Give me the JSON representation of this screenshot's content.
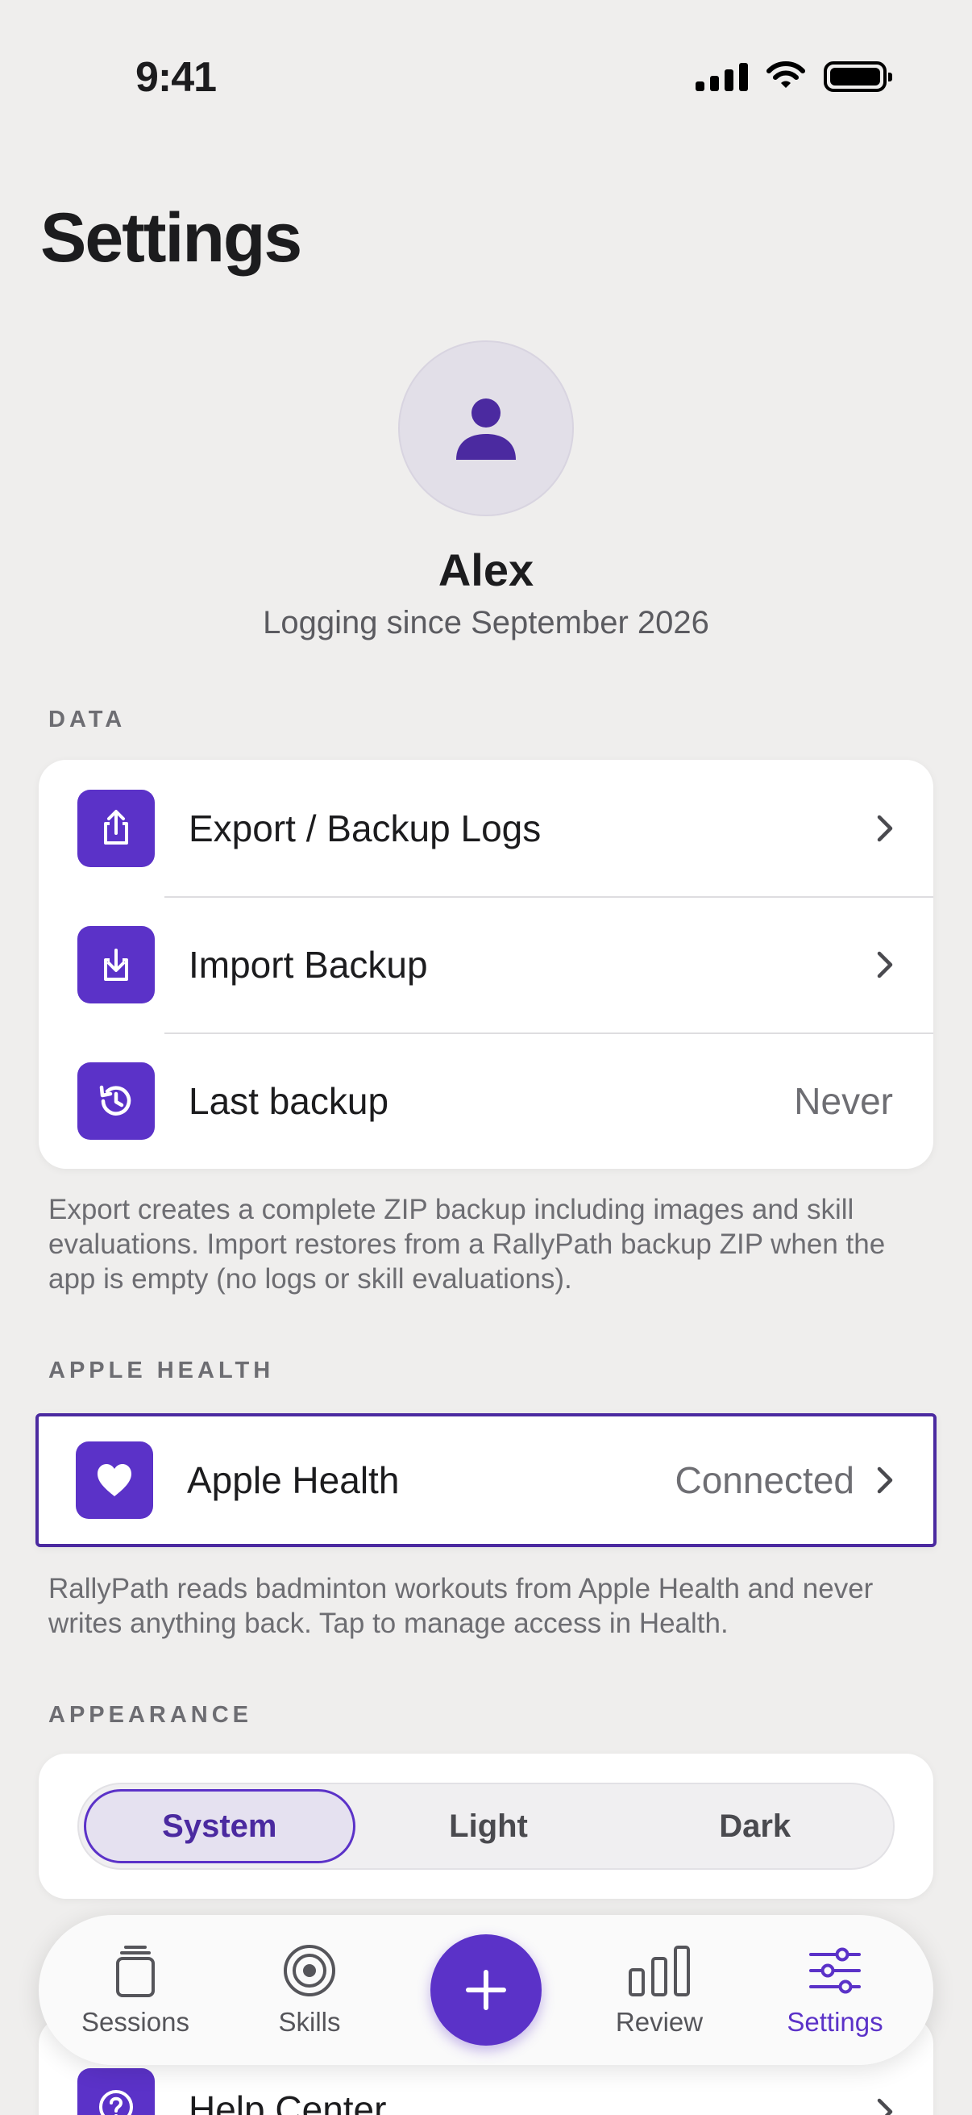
{
  "status_bar": {
    "time": "9:41"
  },
  "page": {
    "title": "Settings"
  },
  "profile": {
    "name": "Alex",
    "subtitle": "Logging since September 2026"
  },
  "data_section": {
    "label": "DATA",
    "rows": [
      {
        "label": "Export / Backup Logs",
        "icon": "export-icon"
      },
      {
        "label": "Import Backup",
        "icon": "import-icon"
      },
      {
        "label": "Last backup",
        "value": "Never",
        "icon": "history-icon"
      }
    ],
    "footnote": "Export creates a complete ZIP backup including images and skill evaluations. Import restores from a RallyPath backup ZIP when the app is empty (no logs or skill evaluations)."
  },
  "health_section": {
    "label": "APPLE HEALTH",
    "row": {
      "label": "Apple Health",
      "value": "Connected",
      "icon": "heart-icon"
    },
    "footnote": "RallyPath reads badminton workouts from Apple Health and never writes anything back. Tap to manage access in Health."
  },
  "appearance_section": {
    "label": "APPEARANCE",
    "options": [
      "System",
      "Light",
      "Dark"
    ],
    "selected": "System"
  },
  "peek_row": {
    "label": "Help Center",
    "icon": "help-icon"
  },
  "tabbar": {
    "tabs": [
      {
        "label": "Sessions",
        "icon": "cards-icon"
      },
      {
        "label": "Skills",
        "icon": "target-icon"
      },
      {
        "label": "Review",
        "icon": "bar-chart-icon"
      },
      {
        "label": "Settings",
        "icon": "sliders-icon"
      }
    ],
    "active": "Settings",
    "fab_icon": "plus-icon"
  },
  "colors": {
    "accent": "#5b32c8",
    "background": "#efeeed",
    "card": "#ffffff"
  }
}
